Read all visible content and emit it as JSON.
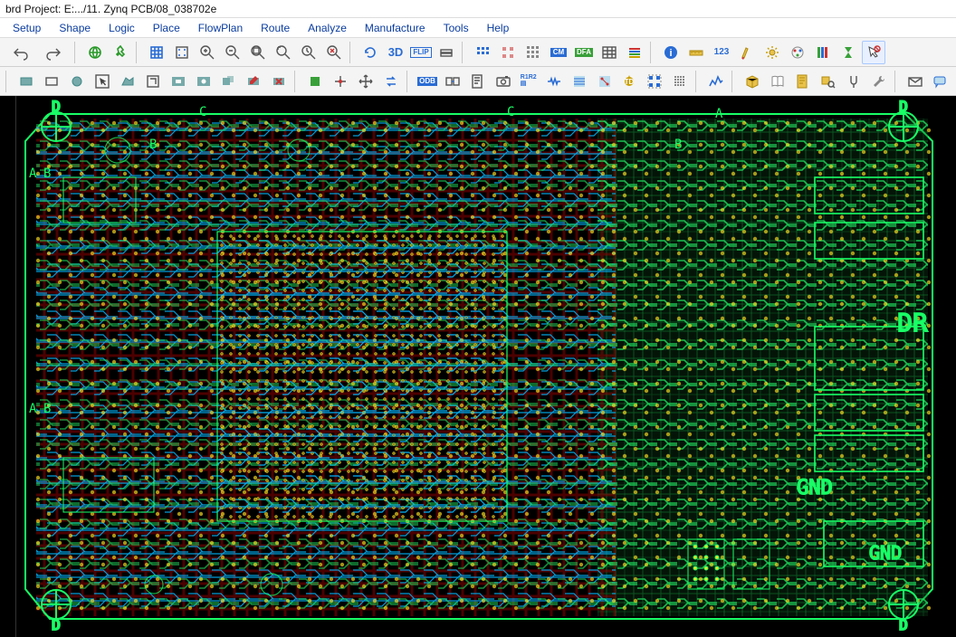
{
  "title": "brd  Project: E:.../11. Zynq PCB/08_038702e",
  "menus": {
    "setup": "Setup",
    "shape": "Shape",
    "logic": "Logic",
    "place": "Place",
    "flowplan": "FlowPlan",
    "route": "Route",
    "analyze": "Analyze",
    "manufacture": "Manufacture",
    "tools": "Tools",
    "help": "Help"
  },
  "toolbar1": {
    "undo": "undo",
    "redo": "redo",
    "globe": "globe",
    "pin": "pin",
    "grid1": "grid-toolbar",
    "grid2": "grid-dot",
    "zoom_in": "zoom-in",
    "zoom_out": "zoom-out",
    "zoom_fit": "zoom-fit",
    "zoom_window": "zoom-window",
    "zoom_prev": "zoom-previous",
    "zoom_sel": "zoom-selection",
    "rotate": "rotate",
    "view3d": "3D",
    "flip": "FLIP",
    "layer_up": "layer-up",
    "layer_down": "layer-down",
    "netlist": "netlist",
    "ratsnest": "ratsnest",
    "constraint": "constraint-mgr",
    "dfa": "DFA",
    "drc": "DRC",
    "xsection": "cross-section",
    "info": "info",
    "ruler": "measure",
    "dims": "dimension",
    "highlight": "highlight",
    "sun": "visibility",
    "color": "color-palette",
    "layers": "layer-stack",
    "hourglass": "auto",
    "cursor": "select-by"
  },
  "toolbar2": {
    "align_l": "align-left",
    "align_c": "align-center",
    "align_r": "align-right",
    "shape_rect": "rect",
    "shape_circ": "circle",
    "shape_arrow": "arrow",
    "shape_poly": "polygon",
    "shape_line": "line",
    "shape_void": "void",
    "shape_edit": "shape-edit",
    "shape_del": "shape-delete",
    "place_comp": "place-component",
    "place_manual": "place-manual",
    "move": "move",
    "swap": "swap",
    "odb": "ODB",
    "cross": "cross-probe",
    "script": "script",
    "camera": "snapshot",
    "r1r2": "diff-pair",
    "len": "length",
    "bund": "bundle",
    "net": "net-sched",
    "td": "teardrop",
    "group": "group",
    "matrix": "matrix",
    "graph": "signal",
    "box": "package",
    "book": "library",
    "report": "report",
    "find": "find-component",
    "tune": "tune",
    "wrench": "tools",
    "mail": "export",
    "msg": "messages"
  },
  "pcb": {
    "refs_visible": [
      "A",
      "B",
      "C",
      "D",
      "DR",
      "GND"
    ],
    "layer_colors": {
      "top_cu": "#3cff3c",
      "inner_cu": "#00c8ff",
      "inner2_cu": "#ff2f2f",
      "silk": "#ffe020",
      "outline": "#00ff88",
      "drill": "#ffff66"
    }
  }
}
